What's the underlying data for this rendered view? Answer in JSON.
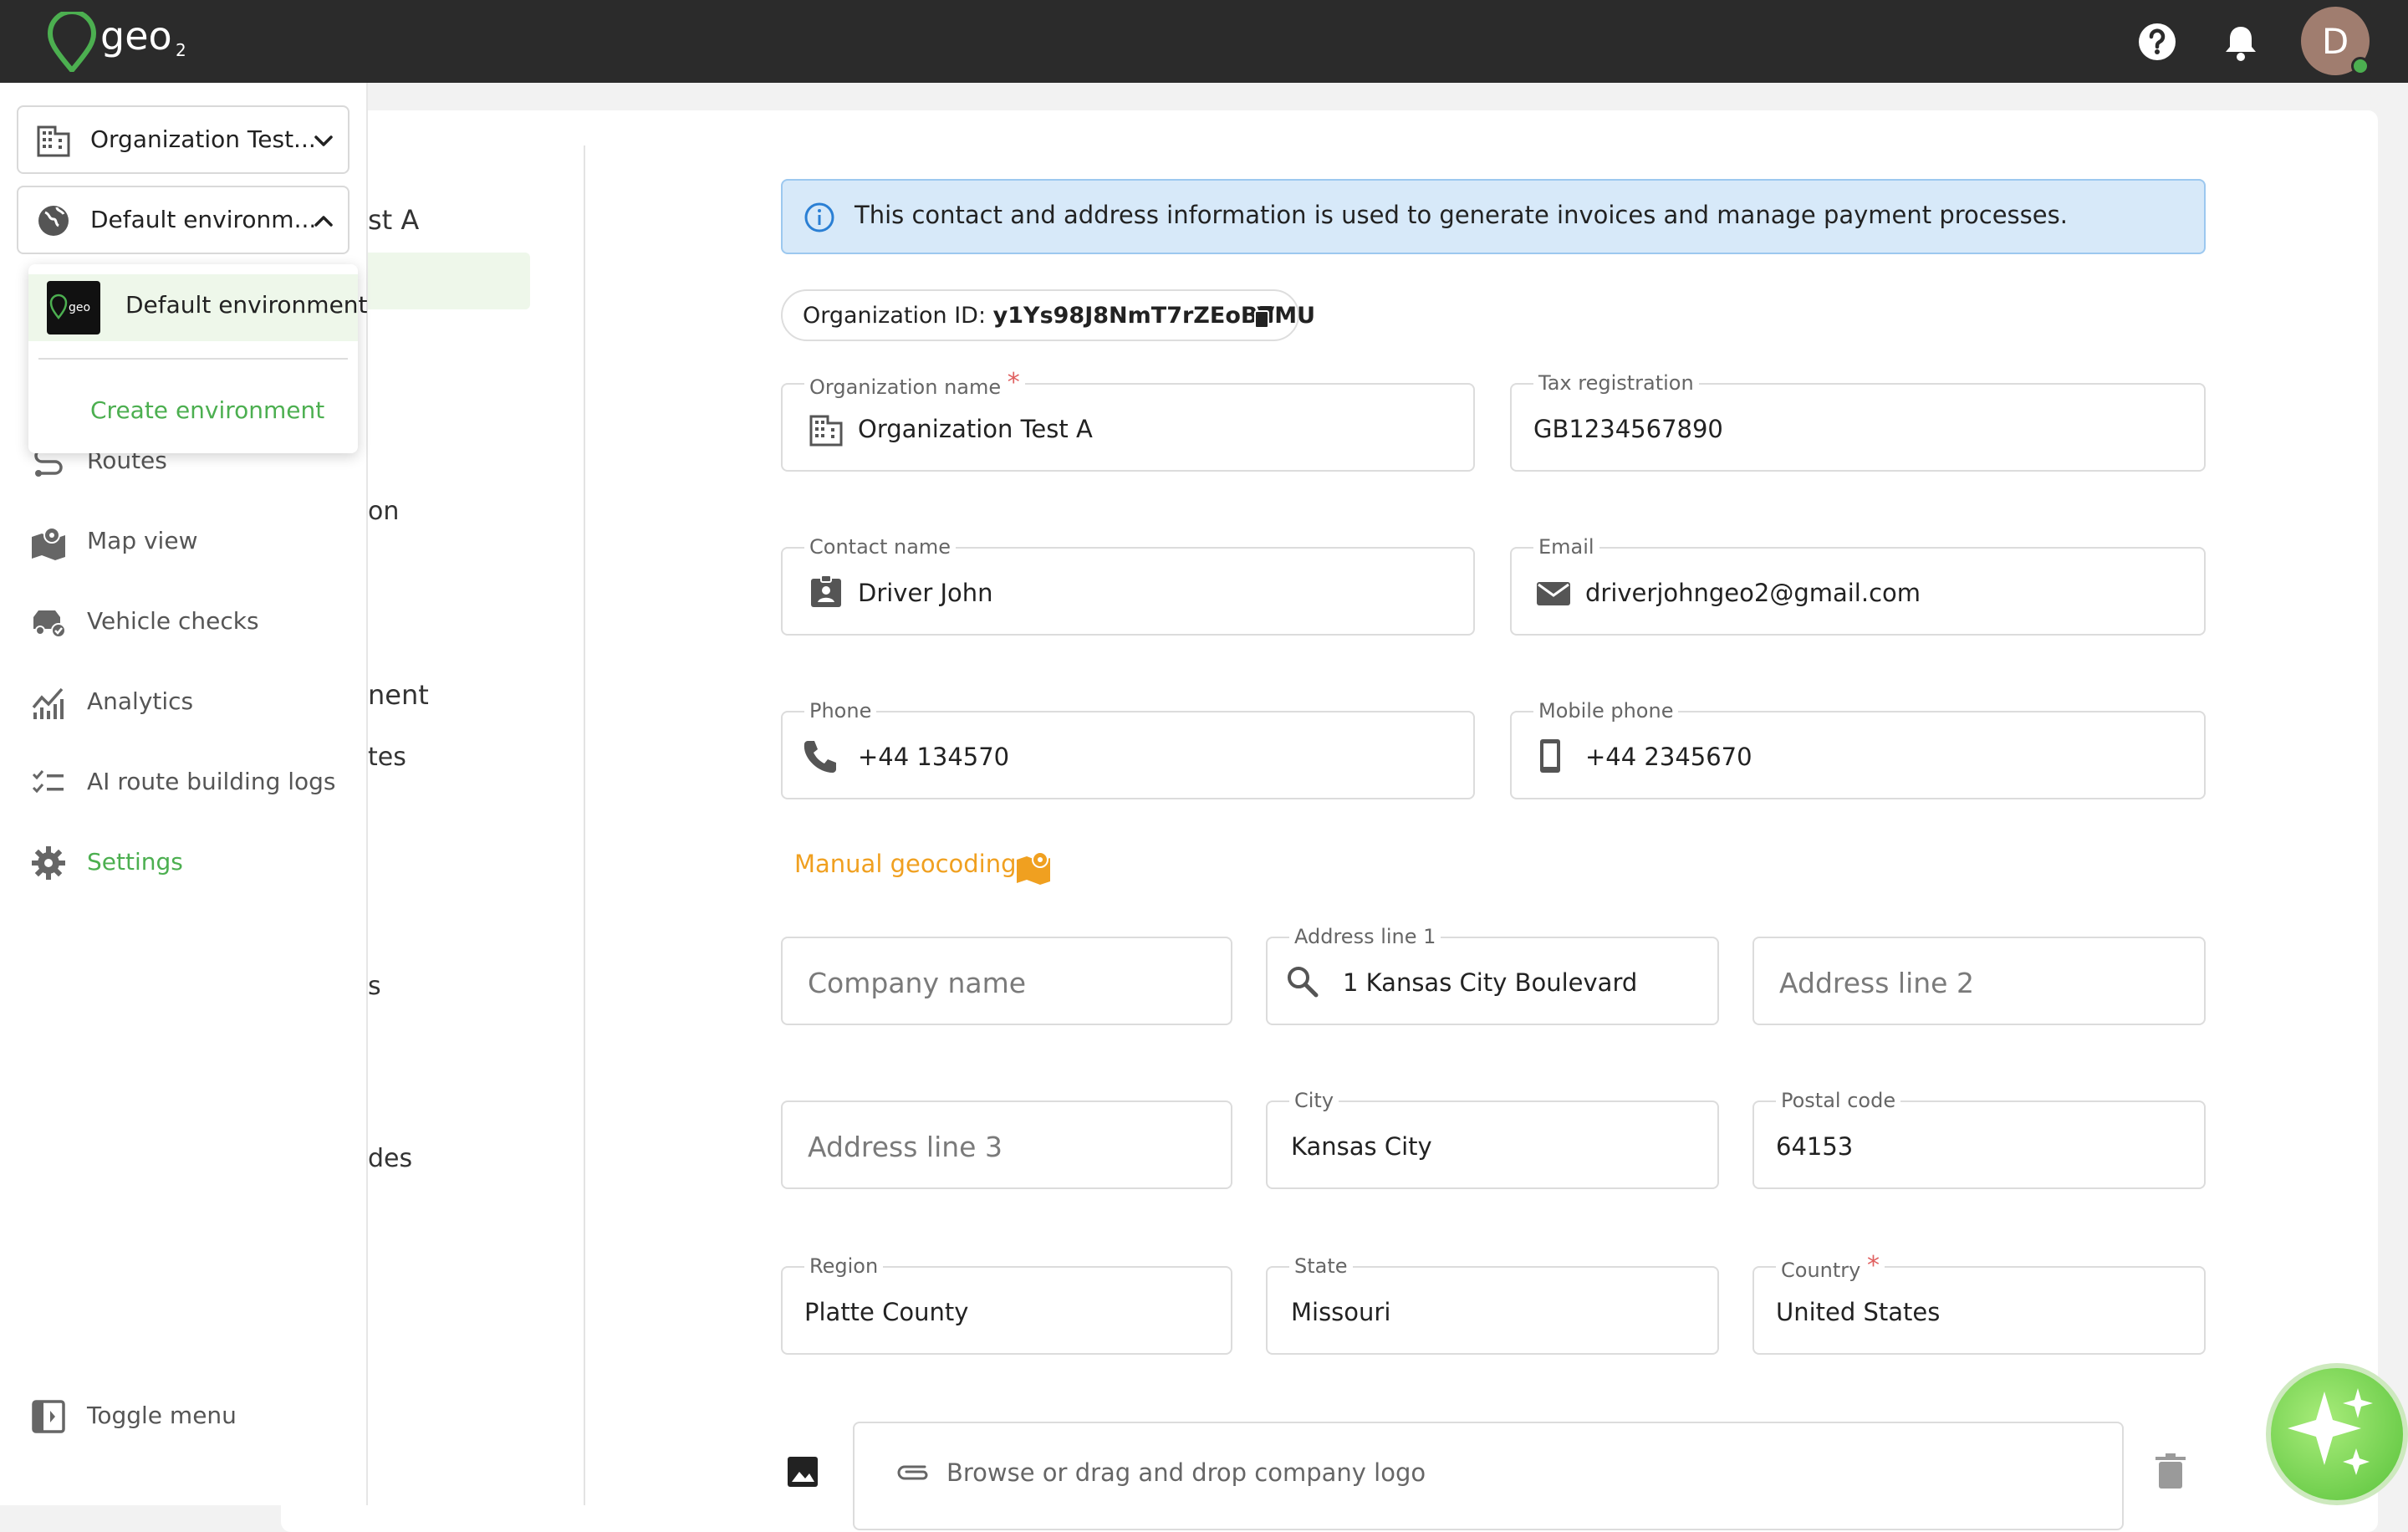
{
  "brand": {
    "name": "geo",
    "subscript": "2",
    "accent": "#4caf50",
    "topbar_bg": "#2b2b2b"
  },
  "header": {
    "avatar_initial": "D",
    "help_icon": "help-icon",
    "bell_icon": "bell-icon"
  },
  "sidebar": {
    "organization_selector": "Organization Test...",
    "environment_selector": "Default environm...",
    "environment_menu": {
      "items": [
        "Default environment"
      ],
      "create_label": "Create environment"
    },
    "items": [
      {
        "label": "Routes",
        "icon": "routes-icon"
      },
      {
        "label": "Map view",
        "icon": "map-icon"
      },
      {
        "label": "Vehicle checks",
        "icon": "vehicle-check-icon"
      },
      {
        "label": "Analytics",
        "icon": "analytics-icon"
      },
      {
        "label": "AI route building logs",
        "icon": "checklist-icon"
      },
      {
        "label": "Settings",
        "icon": "gear-icon",
        "active": true
      }
    ],
    "toggle_label": "Toggle menu"
  },
  "background_nav": [
    "st A",
    "on",
    "nent",
    "tes",
    "s",
    "des"
  ],
  "form": {
    "info_banner": "This contact and address information is used to generate invoices and manage payment processes.",
    "org_id_label": "Organization ID:",
    "org_id_value": "y1Ys98J8NmT7rZEoBVMU",
    "org_name": {
      "label": "Organization name",
      "required": "*",
      "value": "Organization Test A"
    },
    "tax": {
      "label": "Tax registration",
      "value": "GB1234567890"
    },
    "contact": {
      "label": "Contact name",
      "value": "Driver John"
    },
    "email": {
      "label": "Email",
      "value": "driverjohngeo2@gmail.com"
    },
    "phone": {
      "label": "Phone",
      "value": "+44 134570"
    },
    "mobile": {
      "label": "Mobile phone",
      "value": "+44 2345670"
    },
    "geocoding_label": "Manual geocoding",
    "company_name": {
      "placeholder": "Company name"
    },
    "address1": {
      "label": "Address line 1",
      "value": "1 Kansas City Boulevard"
    },
    "address2": {
      "placeholder": "Address line 2"
    },
    "address3": {
      "placeholder": "Address line 3"
    },
    "city": {
      "label": "City",
      "value": "Kansas City"
    },
    "postal": {
      "label": "Postal code",
      "value": "64153"
    },
    "region": {
      "label": "Region",
      "value": "Platte County"
    },
    "state": {
      "label": "State",
      "value": "Missouri"
    },
    "country": {
      "label": "Country",
      "required": "*",
      "value": "United States"
    },
    "logo_upload": "Browse or drag and drop company logo"
  }
}
